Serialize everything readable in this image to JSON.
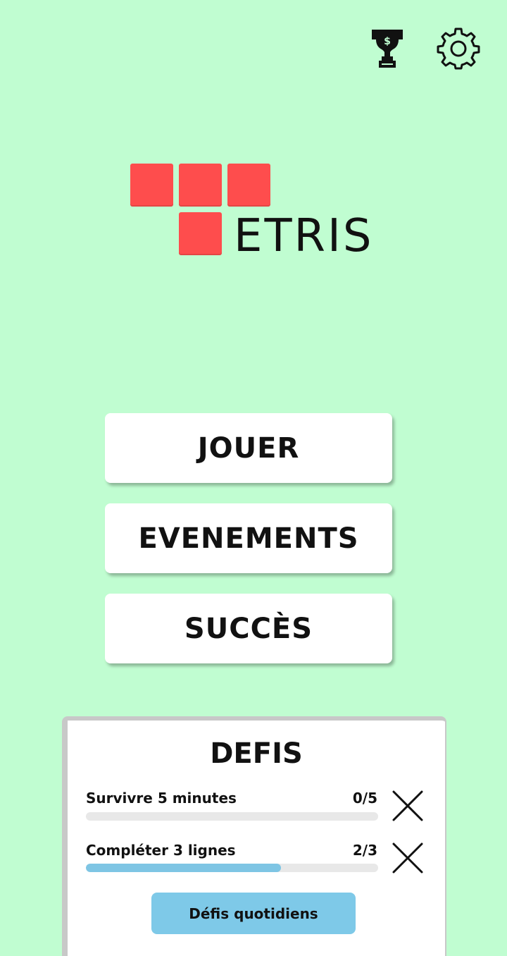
{
  "header": {
    "trophy_icon": "trophy-icon",
    "settings_icon": "gear-icon"
  },
  "logo": {
    "block_color": "#fe4d4d",
    "text": "ETRIS"
  },
  "menu": {
    "play_label": "JOUER",
    "events_label": "EVENEMENTS",
    "achievements_label": "SUCCÈS"
  },
  "challenges": {
    "title": "DEFIS",
    "items": [
      {
        "label": "Survivre 5 minutes",
        "count": "0/5",
        "progress": 0
      },
      {
        "label": "Compléter 3 lignes",
        "count": "2/3",
        "progress": 0.6667
      }
    ],
    "daily_button_label": "Défis quotidiens"
  },
  "colors": {
    "background": "#c0fdd1",
    "accent_blue": "#7ec9e8"
  }
}
